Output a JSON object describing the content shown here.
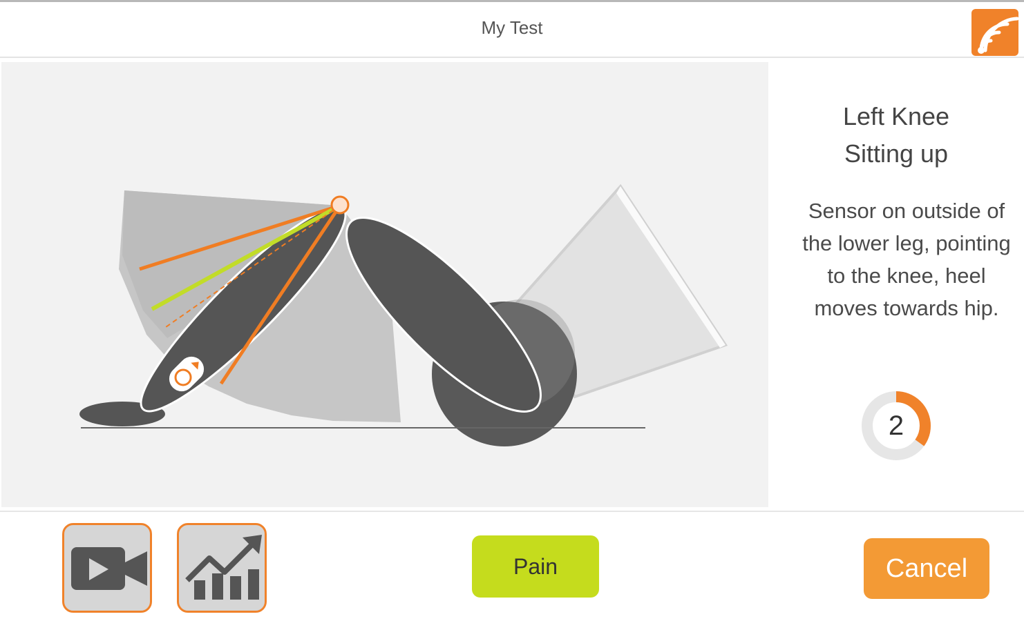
{
  "window": {
    "title": "My Test"
  },
  "logo": {
    "icon": "wireless-signal-logo",
    "color": "#f0822a"
  },
  "illustration": {
    "subject": "knee-flexion-lying",
    "accent": "#f07d23",
    "target_color": "#c2dc28"
  },
  "info": {
    "joint_line1": "Left Knee",
    "joint_line2": "Sitting up",
    "instructions": "Sensor on outside of the lower leg, pointing to the knee, heel moves towards hip.",
    "counter": "2",
    "counter_progress": 0.35
  },
  "toolbar": {
    "video_icon": "video-camera-icon",
    "chart_icon": "trend-chart-icon",
    "pain_label": "Pain",
    "cancel_label": "Cancel"
  },
  "colors": {
    "accent": "#f0822a",
    "pain": "#c5dc1d",
    "cancel": "#f39a35"
  }
}
